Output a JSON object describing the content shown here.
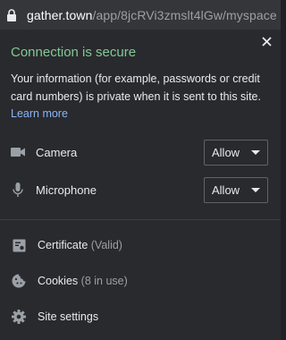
{
  "address_bar": {
    "host": "gather.town",
    "path": "/app/8jcRVi3zmslt4lGw/myspace"
  },
  "site_info": {
    "title": "Connection is secure",
    "description": "Your information (for example, passwords or credit card numbers) is private when it is sent to this site.",
    "learn_more": "Learn more"
  },
  "permissions": [
    {
      "label": "Camera",
      "value": "Allow",
      "icon": "camera-icon"
    },
    {
      "label": "Microphone",
      "value": "Allow",
      "icon": "microphone-icon"
    }
  ],
  "links": [
    {
      "label": "Certificate",
      "sub": "(Valid)",
      "icon": "certificate-icon"
    },
    {
      "label": "Cookies",
      "sub": "(8 in use)",
      "icon": "cookie-icon"
    },
    {
      "label": "Site settings",
      "sub": "",
      "icon": "gear-icon"
    }
  ],
  "colors": {
    "secure_green": "#81c995",
    "link_blue": "#8ab4f8",
    "panel_bg": "#292a2d"
  }
}
